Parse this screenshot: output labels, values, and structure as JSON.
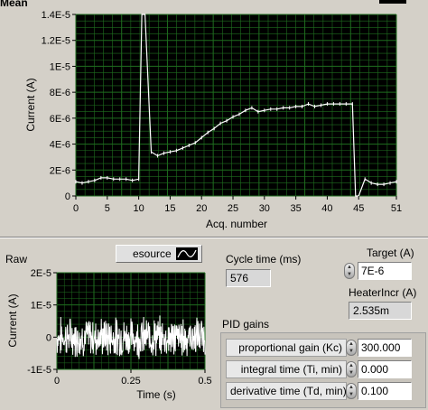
{
  "top_section": {
    "title": "Mean"
  },
  "mean_chart": {
    "ylabel": "Current (A)",
    "xlabel": "Acq. number",
    "yticks": [
      "0",
      "2E-6",
      "4E-6",
      "6E-6",
      "8E-6",
      "1E-5",
      "1.2E-5",
      "1.4E-5"
    ],
    "xticks": [
      "0",
      "5",
      "10",
      "15",
      "20",
      "25",
      "30",
      "35",
      "40",
      "45",
      "51"
    ]
  },
  "raw_section": {
    "title": "Raw"
  },
  "raw_chart": {
    "ylabel": "Current (A)",
    "xlabel": "Time (s)",
    "yticks": [
      "-1E-5",
      "0",
      "1E-5",
      "2E-5"
    ],
    "xticks": [
      "0",
      "0.25",
      "0.5"
    ]
  },
  "legend": {
    "label": "esource"
  },
  "cycle_time": {
    "label": "Cycle time (ms)",
    "value": "576"
  },
  "target": {
    "label": "Target (A)",
    "value": "7E-6"
  },
  "heater_incr": {
    "label": "HeaterIncr (A)",
    "value": "2.535m"
  },
  "pid": {
    "title": "PID gains",
    "proportional_label": "proportional gain (Kc)",
    "proportional_value": "300.000",
    "integral_label": "integral time (Ti, min)",
    "integral_value": "0.000",
    "derivative_label": "derivative time (Td, min)",
    "derivative_value": "0.100"
  },
  "colors": {
    "plot_bg": "#000000",
    "grid": "#1f6e1f",
    "trace": "#ffffff",
    "panel": "#d4d0c8"
  },
  "chart_data": [
    {
      "type": "line",
      "title": "Mean",
      "xlabel": "Acq. number",
      "ylabel": "Current (A)",
      "xlim": [
        0,
        51
      ],
      "ylim": [
        0,
        1.4e-05
      ],
      "grid": true,
      "series": [
        {
          "x": [
            0,
            1,
            2,
            3,
            4,
            5,
            6,
            7,
            8,
            9,
            10,
            10.5,
            11,
            12,
            13,
            14,
            15,
            16,
            17,
            18,
            19,
            20,
            21,
            22,
            23,
            24,
            25,
            26,
            27,
            28,
            29,
            30,
            31,
            32,
            33,
            34,
            35,
            36,
            37,
            38,
            39,
            40,
            41,
            42,
            43,
            44,
            44.5,
            45,
            46,
            47,
            48,
            49,
            50,
            51
          ],
          "y": [
            1.1e-06,
            1e-06,
            1.1e-06,
            1.2e-06,
            1.4e-06,
            1.4e-06,
            1.3e-06,
            1.3e-06,
            1.3e-06,
            1.2e-06,
            1.3e-06,
            1.4e-05,
            1.4e-05,
            3.4e-06,
            3.1e-06,
            3.3e-06,
            3.4e-06,
            3.5e-06,
            3.7e-06,
            3.9e-06,
            4.1e-06,
            4.5e-06,
            4.9e-06,
            5.2e-06,
            5.6e-06,
            5.8e-06,
            6.1e-06,
            6.3e-06,
            6.6e-06,
            6.8e-06,
            6.5e-06,
            6.6e-06,
            6.7e-06,
            6.7e-06,
            6.8e-06,
            6.8e-06,
            6.9e-06,
            6.9e-06,
            7.1e-06,
            6.9e-06,
            7e-06,
            7.1e-06,
            7.1e-06,
            7.1e-06,
            7.1e-06,
            7.1e-06,
            0,
            0,
            1.3e-06,
            1e-06,
            9e-07,
            9e-07,
            1e-06,
            1.1e-06
          ]
        }
      ]
    },
    {
      "type": "line",
      "title": "Raw",
      "xlabel": "Time (s)",
      "ylabel": "Current (A)",
      "xlim": [
        0,
        0.5
      ],
      "ylim": [
        -1e-05,
        2e-05
      ],
      "grid": true,
      "series": [
        {
          "description_values": "noise around 0, amplitude ~±5E-6"
        }
      ]
    }
  ]
}
